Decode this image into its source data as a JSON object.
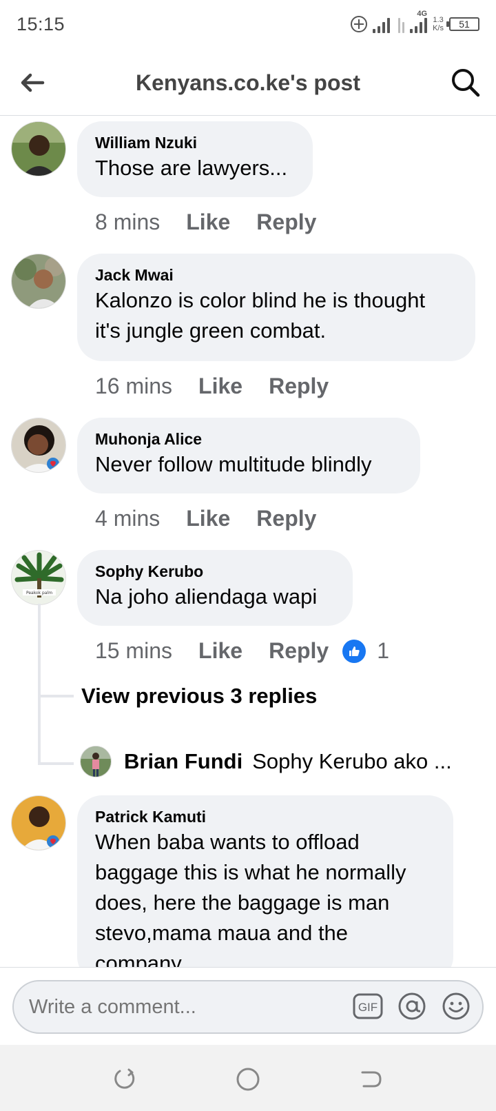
{
  "status_bar": {
    "time": "15:15",
    "network_type": "4G",
    "net_speed_value": "1.3",
    "net_speed_unit": "K/s",
    "battery": "51"
  },
  "header": {
    "title": "Kenyans.co.ke's post",
    "back_icon": "arrow-left-icon",
    "search_icon": "search-icon"
  },
  "comments": [
    {
      "author": "William Nzuki",
      "text": "Those are lawyers...",
      "time": "8 mins",
      "like": "Like",
      "reply": "Reply"
    },
    {
      "author": "Jack Mwai",
      "text_lines": [
        "Kalonzo is color blind he is thought",
        "it's jungle green combat."
      ],
      "time": "16 mins",
      "like": "Like",
      "reply": "Reply"
    },
    {
      "author": "Muhonja Alice",
      "text": "Never follow multitude blindly",
      "time": "4 mins",
      "like": "Like",
      "reply": "Reply"
    },
    {
      "author": "Sophy Kerubo",
      "text": "Na joho aliendaga wapi",
      "time": "15 mins",
      "like": "Like",
      "reply": "Reply",
      "reaction_count": "1",
      "avatar_caption": "Peakok palm"
    },
    {
      "author": "Patrick Kamuti",
      "text_lines": [
        "When baba wants to offload",
        "baggage this is what he normally",
        "does, here the baggage is man",
        "stevo,mama maua and the",
        "company"
      ]
    }
  ],
  "thread": {
    "view_previous": "View previous 3 replies",
    "reply_author": "Brian Fundi",
    "reply_preview": "Sophy Kerubo ako ..."
  },
  "composer": {
    "placeholder": "Write a comment...",
    "gif_label": "GIF",
    "mention_icon": "at-icon",
    "emoji_icon": "smiley-icon"
  },
  "colors": {
    "bubble": "#f0f2f5",
    "meta_text": "#65676b",
    "like_blue": "#1877f2"
  }
}
